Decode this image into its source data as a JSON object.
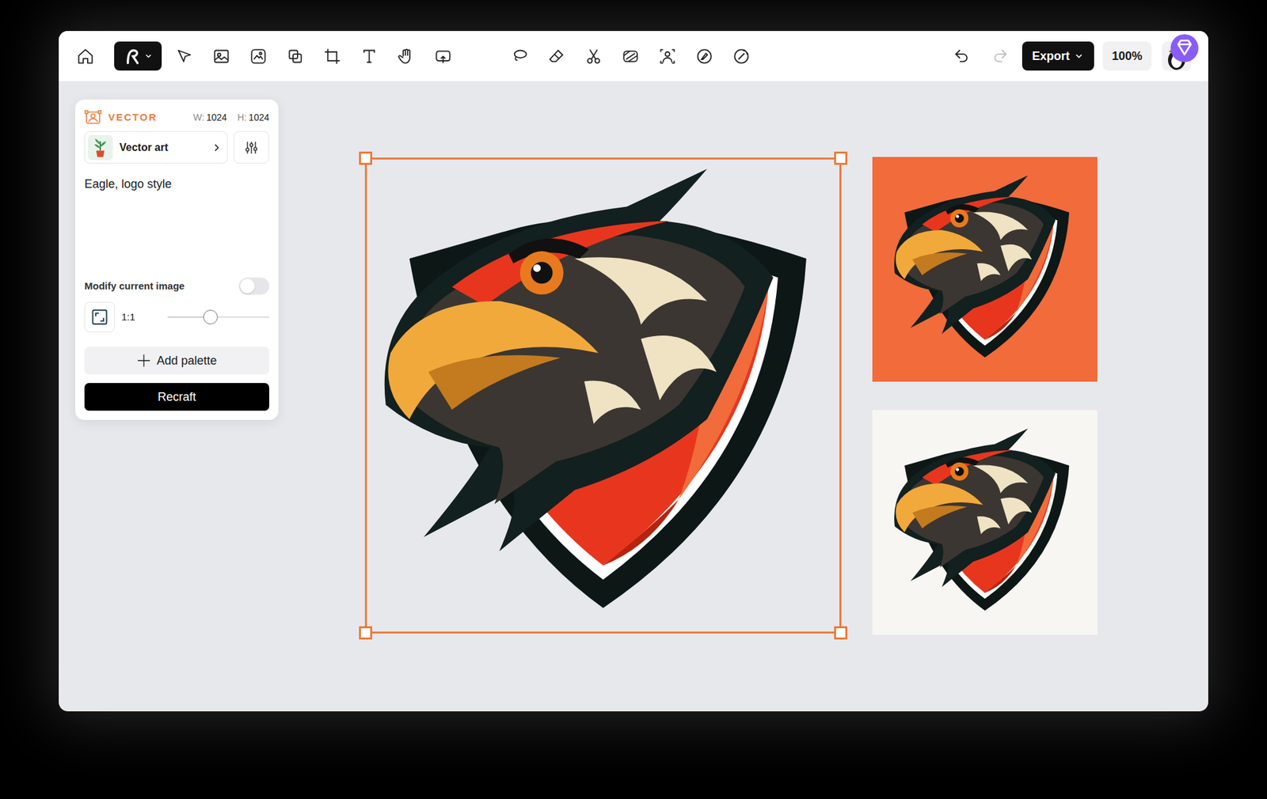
{
  "toolbar": {
    "tool_groups": [
      [
        {
          "selected": true
        },
        {
          "selected": false
        },
        {
          "selected": false
        },
        {
          "selected": false
        },
        {
          "selected": false
        },
        {
          "selected": false
        },
        {
          "selected": false
        },
        {
          "selected": false
        },
        {
          "selected": false
        }
      ],
      [
        {
          "selected": false
        },
        {
          "selected": false
        },
        {
          "selected": false
        },
        {
          "selected": false
        },
        {
          "selected": false
        },
        {
          "selected": false
        },
        {
          "selected": false
        }
      ]
    ],
    "can_undo": true,
    "can_redo": false,
    "export": "Export",
    "zoom": "100%"
  },
  "panel": {
    "mode": "VECTOR",
    "width_label": "W:",
    "width": "1024",
    "height_label": "H:",
    "height": "1024",
    "style": "Vector art",
    "prompt": "Eagle, logo style",
    "modify_label": "Modify current image",
    "modify_on": false,
    "ratio": "1:1",
    "ratio_level": 0.42,
    "add_palette": "Add palette",
    "submit": "Recraft"
  },
  "images": [
    {
      "selected": true,
      "color": "#e7e8ec"
    },
    {
      "selected": false,
      "color": "#f26b3a"
    },
    {
      "selected": false,
      "color": "#f7f6f2"
    }
  ]
}
